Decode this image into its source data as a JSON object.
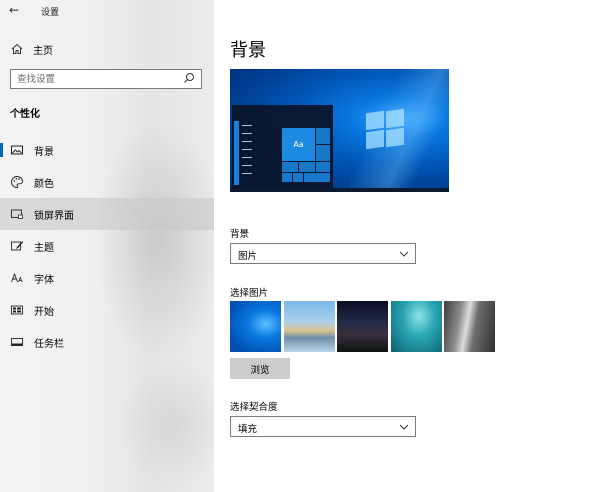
{
  "window": {
    "back_glyph": "←",
    "title": "设置"
  },
  "sidebar": {
    "home_label": "主页",
    "search_placeholder": "查找设置",
    "section_title": "个性化",
    "items": [
      {
        "label": "背景",
        "icon": "picture-icon",
        "active": true
      },
      {
        "label": "颜色",
        "icon": "palette-icon"
      },
      {
        "label": "锁屏界面",
        "icon": "lock-screen-icon",
        "hover": true
      },
      {
        "label": "主题",
        "icon": "theme-brush-icon"
      },
      {
        "label": "字体",
        "icon": "font-icon"
      },
      {
        "label": "开始",
        "icon": "start-grid-icon"
      },
      {
        "label": "任务栏",
        "icon": "taskbar-icon"
      }
    ]
  },
  "main": {
    "title": "背景",
    "preview_tile_text": "Aa",
    "background_label": "背景",
    "background_value": "图片",
    "choose_picture_label": "选择图片",
    "browse_label": "浏览",
    "fit_label": "选择契合度",
    "fit_value": "填充"
  },
  "colors": {
    "accent": "#0067c0",
    "button_gray": "#cccccc"
  }
}
